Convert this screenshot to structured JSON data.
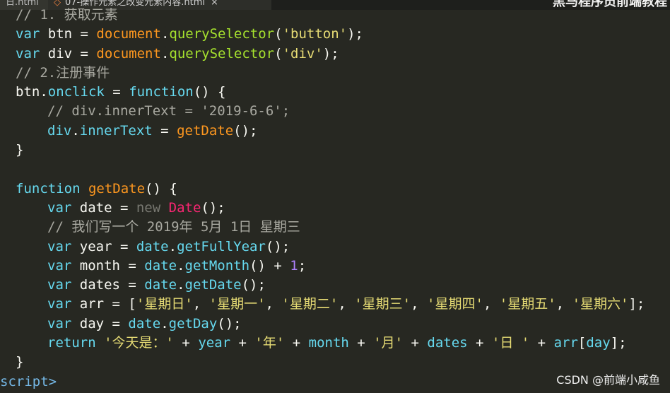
{
  "tabs": {
    "inactive_label": "日.html",
    "active_label": "07-操作元素之改变元素内容.html",
    "active_dirty_marker": "◇",
    "close_glyph": "×"
  },
  "brand_text": "黑马程序员前端教程",
  "watermark": "CSDN @前端小咸鱼",
  "code": {
    "l0": "// 1. 获取元素",
    "l1": {
      "kw": "var",
      "name": " btn ",
      "eq": "= ",
      "obj": "document",
      "dot": ".",
      "m": "querySelector",
      "o": "(",
      "s": "'button'",
      "c": ");"
    },
    "l2": {
      "kw": "var",
      "name": " div ",
      "eq": "= ",
      "obj": "document",
      "dot": ".",
      "m": "querySelector",
      "o": "(",
      "s": "'div'",
      "c": ");"
    },
    "l3": "// 2.注册事件",
    "l4": {
      "obj": "btn",
      "dot": ".",
      "prop": "onclick",
      "eq": " = ",
      "kw": "function",
      "rest": "() {"
    },
    "l5": "// div.innerText = '2019-6-6';",
    "l6": {
      "obj": "div",
      "dot": ".",
      "prop": "innerText",
      "eq": " = ",
      "fn": "getDate",
      "rest": "();"
    },
    "l7": "}",
    "l8": "",
    "l9": {
      "kw": "function",
      "sp": " ",
      "fn": "getDate",
      "rest": "() {"
    },
    "l10": {
      "kw": "var",
      "name": " date ",
      "eq": "= ",
      "new": "new",
      "sp": " ",
      "cls": "Date",
      "rest": "();"
    },
    "l11": "// 我们写一个 2019年 5月 1日 星期三",
    "l12": {
      "kw": "var",
      "name": " year ",
      "eq": "= ",
      "obj": "date",
      "dot": ".",
      "fn": "getFullYear",
      "rest": "();"
    },
    "l13": {
      "kw": "var",
      "name": " month ",
      "eq": "= ",
      "obj": "date",
      "dot": ".",
      "fn": "getMonth",
      "mid": "() + ",
      "num": "1",
      "rest": ";"
    },
    "l14": {
      "kw": "var",
      "name": " dates ",
      "eq": "= ",
      "obj": "date",
      "dot": ".",
      "fn": "getDate",
      "rest": "();"
    },
    "l15": {
      "kw": "var",
      "name": " arr ",
      "eq": "= ",
      "open": "[",
      "s1": "'星期日'",
      "s2": "'星期一'",
      "s3": "'星期二'",
      "s4": "'星期三'",
      "s5": "'星期四'",
      "s6": "'星期五'",
      "s7": "'星期六'",
      "sep": ", ",
      "close": "];"
    },
    "l16": {
      "kw": "var",
      "name": " day ",
      "eq": "= ",
      "obj": "date",
      "dot": ".",
      "fn": "getDay",
      "rest": "();"
    },
    "l17": {
      "kw": "return",
      "sp": " ",
      "s1": "'今天是：'",
      "p1": " + ",
      "v1": "year",
      "p2": " + ",
      "s2": "'年'",
      "p3": " + ",
      "v2": "month",
      "p4": " + ",
      "s3": "'月'",
      "p5": " + ",
      "v3": "dates",
      "p6": " + ",
      "s4": "'日 '",
      "p7": " + ",
      "v4": "arr",
      "o": "[",
      "v5": "day",
      "c": "];"
    },
    "l18": "}",
    "l19": "script>"
  },
  "colors": {
    "background": "#272822",
    "keyword": "#66d9ef",
    "string": "#e6db74",
    "property": "#a6e22e",
    "comment": "#a8a8a0"
  }
}
